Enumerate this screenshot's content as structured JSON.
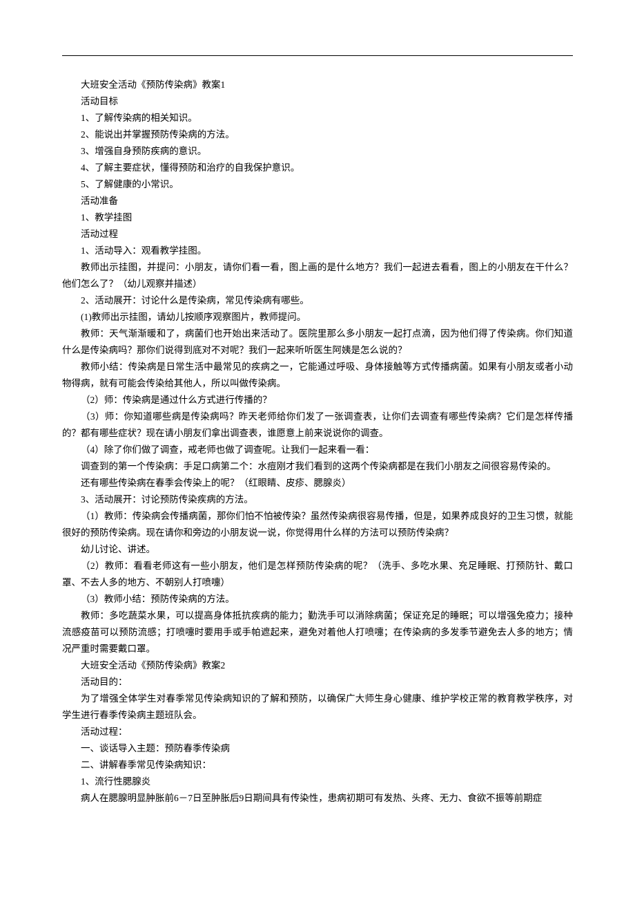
{
  "doc": {
    "lines": [
      "大班安全活动《预防传染病》教案1",
      "活动目标",
      "1、了解传染病的相关知识。",
      "2、能说出并掌握预防传染病的方法。",
      "3、增强自身预防疾病的意识。",
      "4、了解主要症状，懂得预防和治疗的自我保护意识。",
      "5、了解健康的小常识。",
      "活动准备",
      "1、教学挂图",
      "活动过程",
      "1、活动导入：观看教学挂图。",
      "教师出示挂图，并提问：小朋友，请你们看一看，图上画的是什么地方？我们一起进去看看，图上的小朋友在干什么？他们怎么了？（幼儿观察并描述）",
      "2、活动展开：讨论什么是传染病，常见传染病有哪些。",
      "(1)教师出示挂图，请幼儿按顺序观察图片，教师提问。",
      "教师：天气渐渐暖和了，病菌们也开始出来活动了。医院里那么多小朋友一起打点滴，因为他们得了传染病。你们知道什么是传染病吗？那你们说得到底对不对呢？我们一起来听听医生阿姨是怎么说的？",
      "教师小结：传染病是日常生活中最常见的疾病之一，它能通过呼吸、身体接触等方式传播病菌。如果有小朋友或者小动物得病，就有可能会传染给其他人，所以叫做传染病。",
      "（2）师：传染病是通过什么方式进行传播的？",
      "（3）师：你知道哪些病是传染病吗？昨天老师给你们发了一张调查表，让你们去调查有哪些传染病？它们是怎样传播的？都有哪些症状？现在请小朋友们拿出调查表，谁愿意上前来说说你的调查。",
      "（4）除了你们做了调查，戒老师也做了调查呢。让我们一起来看一看：",
      "调查到的第一个传染病：手足口病第二个：水痘刚才我们看到的这两个传染病都是在我们小朋友之间很容易传染的。",
      "还有哪些传染病在春季会传染上的呢？（红眼睛、皮疹、腮腺炎）",
      "3、活动展开：讨论预防传染疾病的方法。",
      "（1）教师：传染病会传播病菌，那你们怕不怕被传染？虽然传染病很容易传播，但是，如果养成良好的卫生习惯，就能很好的预防传染病。现在请你和旁边的小朋友说一说，你觉得用什么样的方法可以预防传染病？",
      "幼儿讨论、讲述。",
      "（2）教师：看看老师这有一些小朋友，他们是怎样预防传染病的呢？（洗手、多吃水果、充足睡眠、打预防针、戴口罩、不去人多的地方、不朝别人打喷嚏）",
      "（3）教师小结：预防传染病的方法。",
      "教师：多吃蔬菜水果，可以提高身体抵抗疾病的能力；勤洗手可以消除病菌；保证充足的睡眠；可以增强免疫力；接种流感疫苗可以预防流感；打喷嚏时要用手或手帕遮起来，避免对着他人打喷嚏；在传染病的多发季节避免去人多的地方；情况严重时需要戴口罩。",
      "大班安全活动《预防传染病》教案2",
      "活动目的：",
      "为了增强全体学生对春季常见传染病知识的了解和预防，以确保广大师生身心健康、维护学校正常的教育教学秩序，对学生进行春季传染病主题班队会。",
      "活动过程：",
      "一、谈话导入主题：预防春季传染病",
      "二、讲解春季常见传染病知识：",
      "1、流行性腮腺炎",
      "病人在腮腺明显肿胀前6－7日至肿胀后9日期间具有传染性，患病初期可有发热、头疼、无力、食欲不振等前期症"
    ],
    "wrap_continue": [
      11,
      14,
      15,
      17,
      22,
      26,
      29
    ]
  }
}
